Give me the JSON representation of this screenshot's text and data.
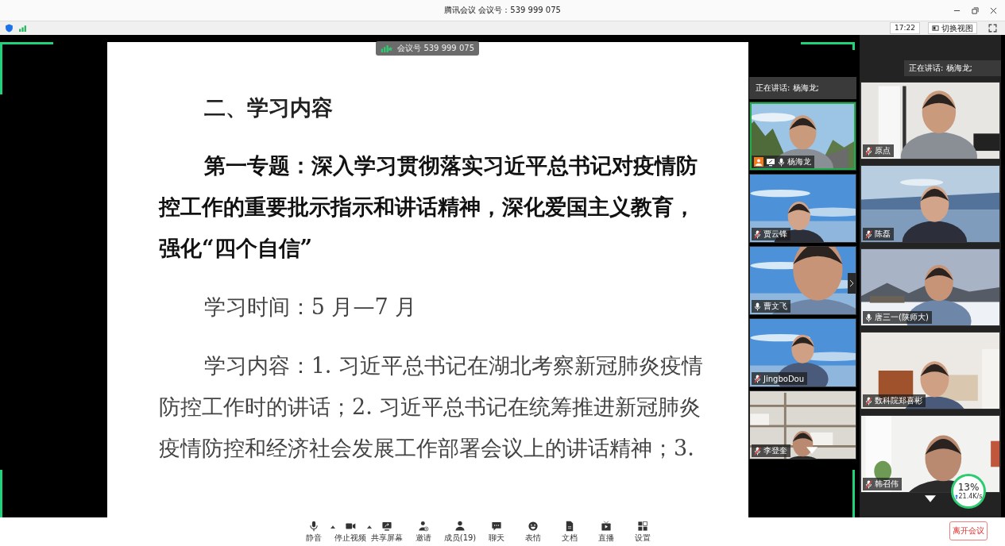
{
  "window": {
    "title": "腾讯会议 会议号：539 999 075"
  },
  "info_bar": {
    "time": "17:22",
    "view_button": "切换视图"
  },
  "meeting_badge": "会议号 539 999 075",
  "slide": {
    "heading": "二、学习内容",
    "paragraphs": [
      {
        "kind": "topic",
        "text": "第一专题：深入学习贯彻落实习近平总书记对疫情防控工作的重要批示指示和讲话精神，深化爱国主义教育，强化“四个自信”"
      },
      {
        "kind": "body",
        "text": "学习时间：5 月—7 月"
      },
      {
        "kind": "body",
        "text": "学习内容：1. 习近平总书记在湖北考察新冠肺炎疫情防控工作时的讲话；2. 习近平总书记在统筹推进新冠肺炎疫情防控和经济社会发展工作部署会议上的讲话精神；3."
      }
    ]
  },
  "left_panel": {
    "speaking": "正在讲话: 杨海龙;",
    "tiles": [
      {
        "name": "杨海龙",
        "muted": false,
        "host": true,
        "speaking": true
      },
      {
        "name": "贾云锋",
        "muted": true,
        "host": false,
        "speaking": false
      },
      {
        "name": "曹文飞",
        "muted": false,
        "host": false,
        "speaking": false
      },
      {
        "name": "JingboDou",
        "muted": true,
        "host": false,
        "speaking": false
      },
      {
        "name": "李登奎",
        "muted": true,
        "host": false,
        "speaking": false
      }
    ]
  },
  "right_panel": {
    "speaking": "正在讲话: 杨海龙;",
    "tiles": [
      {
        "name": "原点",
        "muted": true
      },
      {
        "name": "陈磊",
        "muted": true
      },
      {
        "name": "唐三一(陕师大)",
        "muted": false
      },
      {
        "name": "数科院郑喜彬",
        "muted": true
      },
      {
        "name": "韩召伟",
        "muted": true
      }
    ]
  },
  "toolbar": [
    {
      "kind": "mic",
      "label": "静音",
      "has_menu": true
    },
    {
      "kind": "video",
      "label": "停止视频",
      "has_menu": true
    },
    {
      "kind": "share",
      "label": "共享屏幕",
      "has_menu": false
    },
    {
      "kind": "invite",
      "label": "邀请",
      "has_menu": false
    },
    {
      "kind": "members",
      "label": "成员(19)",
      "has_menu": false
    },
    {
      "kind": "chat",
      "label": "聊天",
      "has_menu": false
    },
    {
      "kind": "emoji",
      "label": "表情",
      "has_menu": false
    },
    {
      "kind": "doc",
      "label": "文档",
      "has_menu": false
    },
    {
      "kind": "live",
      "label": "直播",
      "has_menu": false
    },
    {
      "kind": "settings",
      "label": "设置",
      "has_menu": false
    }
  ],
  "leave_button": "离开会议",
  "network": {
    "usage": "13%",
    "upload": "21.4K/s"
  }
}
